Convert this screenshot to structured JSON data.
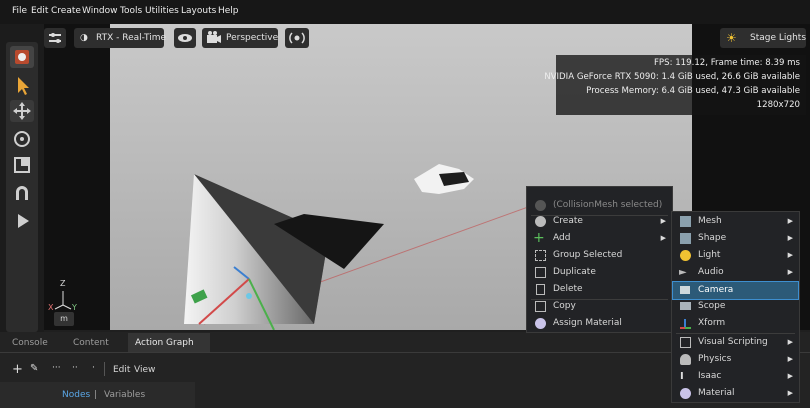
{
  "menubar": {
    "items": [
      "File",
      "Edit",
      "Create",
      "Window",
      "Tools",
      "Utilities",
      "Layouts",
      "Help"
    ]
  },
  "viewport": {
    "render_mode_label": "RTX - Real-Time",
    "camera_label": "Perspective",
    "stage_lights_label": "Stage Lights",
    "stats": {
      "fps": "FPS: 119.12, Frame time: 8.39 ms",
      "gpu": "NVIDIA GeForce RTX 5090: 1.4 GiB used, 26.6 GiB available",
      "process": "Process Memory: 6.4 GiB used, 47.3 GiB available",
      "resolution": "1280x720"
    },
    "axes": {
      "z": "Z",
      "x": "X",
      "y": "Y"
    },
    "unit_button": "m"
  },
  "bottom_panel": {
    "tabs": [
      "Console",
      "Content",
      "Action Graph"
    ],
    "active_tab": "Action Graph",
    "toolbar": {
      "edit": "Edit",
      "view": "View"
    },
    "subtabs": [
      "Nodes",
      "Variables"
    ],
    "subtab_divider": "|"
  },
  "context_menu": {
    "header": "(CollisionMesh selected)",
    "items": [
      "Create",
      "Add",
      "Group Selected",
      "Duplicate",
      "Delete",
      "Copy",
      "Assign Material"
    ]
  },
  "create_submenu": {
    "items": [
      "Mesh",
      "Shape",
      "Light",
      "Audio",
      "Camera",
      "Scope",
      "Xform",
      "Visual Scripting",
      "Physics",
      "Isaac",
      "Material"
    ],
    "highlighted": "Camera"
  },
  "colors": {
    "highlight": "#2c5a78",
    "accent": "#3e8fd0",
    "menu_bg": "#222326"
  }
}
